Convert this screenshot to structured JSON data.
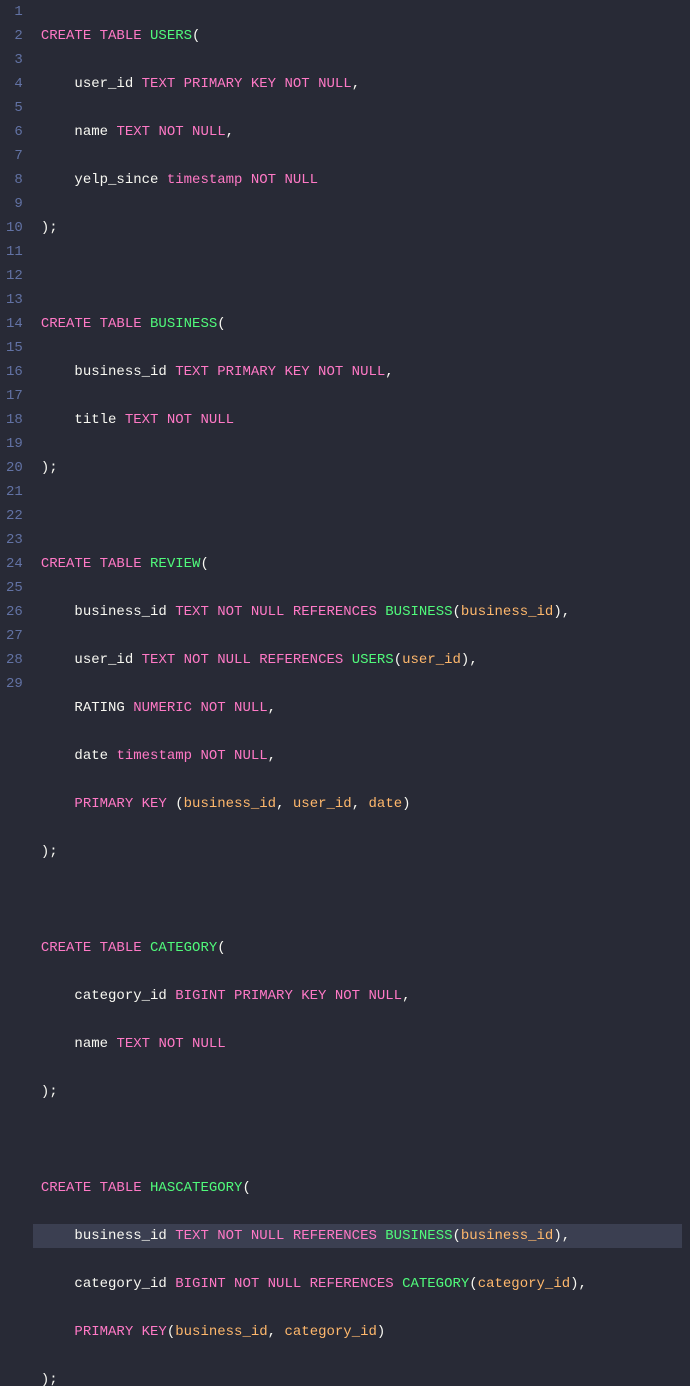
{
  "gutter": [
    "1",
    "2",
    "3",
    "4",
    "5",
    "6",
    "7",
    "8",
    "9",
    "10",
    "11",
    "12",
    "13",
    "14",
    "15",
    "16",
    "17",
    "18",
    "19",
    "20",
    "21",
    "22",
    "23",
    "24",
    "25",
    "26",
    "27",
    "28",
    "29"
  ],
  "code": {
    "l1": {
      "a": "CREATE TABLE ",
      "b": "USERS",
      "c": "("
    },
    "l2": {
      "a": "    user_id ",
      "b": "TEXT PRIMARY KEY NOT NULL",
      "c": ","
    },
    "l3": {
      "a": "    name ",
      "b": "TEXT NOT NULL",
      "c": ","
    },
    "l4": {
      "a": "    yelp_since ",
      "b": "timestamp NOT NULL"
    },
    "l5": {
      "a": ");"
    },
    "l6": {
      "a": ""
    },
    "l7": {
      "a": "CREATE TABLE ",
      "b": "BUSINESS",
      "c": "("
    },
    "l8": {
      "a": "    business_id ",
      "b": "TEXT PRIMARY KEY NOT NULL",
      "c": ","
    },
    "l9": {
      "a": "    title ",
      "b": "TEXT NOT NULL"
    },
    "l10": {
      "a": ");"
    },
    "l11": {
      "a": ""
    },
    "l12": {
      "a": "CREATE TABLE ",
      "b": "REVIEW",
      "c": "("
    },
    "l13": {
      "a": "    business_id ",
      "b": "TEXT NOT NULL REFERENCES ",
      "c": "BUSINESS",
      "d": "(",
      "e": "business_id",
      "f": "),"
    },
    "l14": {
      "a": "    user_id ",
      "b": "TEXT NOT NULL REFERENCES ",
      "c": "USERS",
      "d": "(",
      "e": "user_id",
      "f": "),"
    },
    "l15": {
      "a": "    RATING ",
      "b": "NUMERIC NOT NULL",
      "c": ","
    },
    "l16": {
      "a": "    date ",
      "b": "timestamp NOT NULL",
      "c": ","
    },
    "l17": {
      "a": "    ",
      "b": "PRIMARY KEY ",
      "c": "(",
      "d": "business_id",
      "e": ", ",
      "f": "user_id",
      "g": ", ",
      "h": "date",
      "i": ")"
    },
    "l18": {
      "a": ");"
    },
    "l19": {
      "a": ""
    },
    "l20": {
      "a": "CREATE TABLE ",
      "b": "CATEGORY",
      "c": "("
    },
    "l21": {
      "a": "    category_id ",
      "b": "BIGINT PRIMARY KEY NOT NULL",
      "c": ","
    },
    "l22": {
      "a": "    name ",
      "b": "TEXT NOT NULL"
    },
    "l23": {
      "a": ");"
    },
    "l24": {
      "a": ""
    },
    "l25": {
      "a": "CREATE TABLE ",
      "b": "HASCATEGORY",
      "c": "("
    },
    "l26": {
      "a": "    business_id ",
      "b": "TEXT NOT NULL REFERENCES ",
      "c": "BUSINESS",
      "d": "(",
      "e": "business_id",
      "f": "),"
    },
    "l27": {
      "a": "    category_id ",
      "b": "BIGINT NOT NULL REFERENCES ",
      "c": "CATEGORY",
      "d": "(",
      "e": "category_id",
      "f": "),"
    },
    "l28": {
      "a": "    ",
      "b": "PRIMARY KEY",
      "c": "(",
      "d": "business_id",
      "e": ", ",
      "f": "category_id",
      "g": ")"
    },
    "l29": {
      "a": ");"
    }
  }
}
